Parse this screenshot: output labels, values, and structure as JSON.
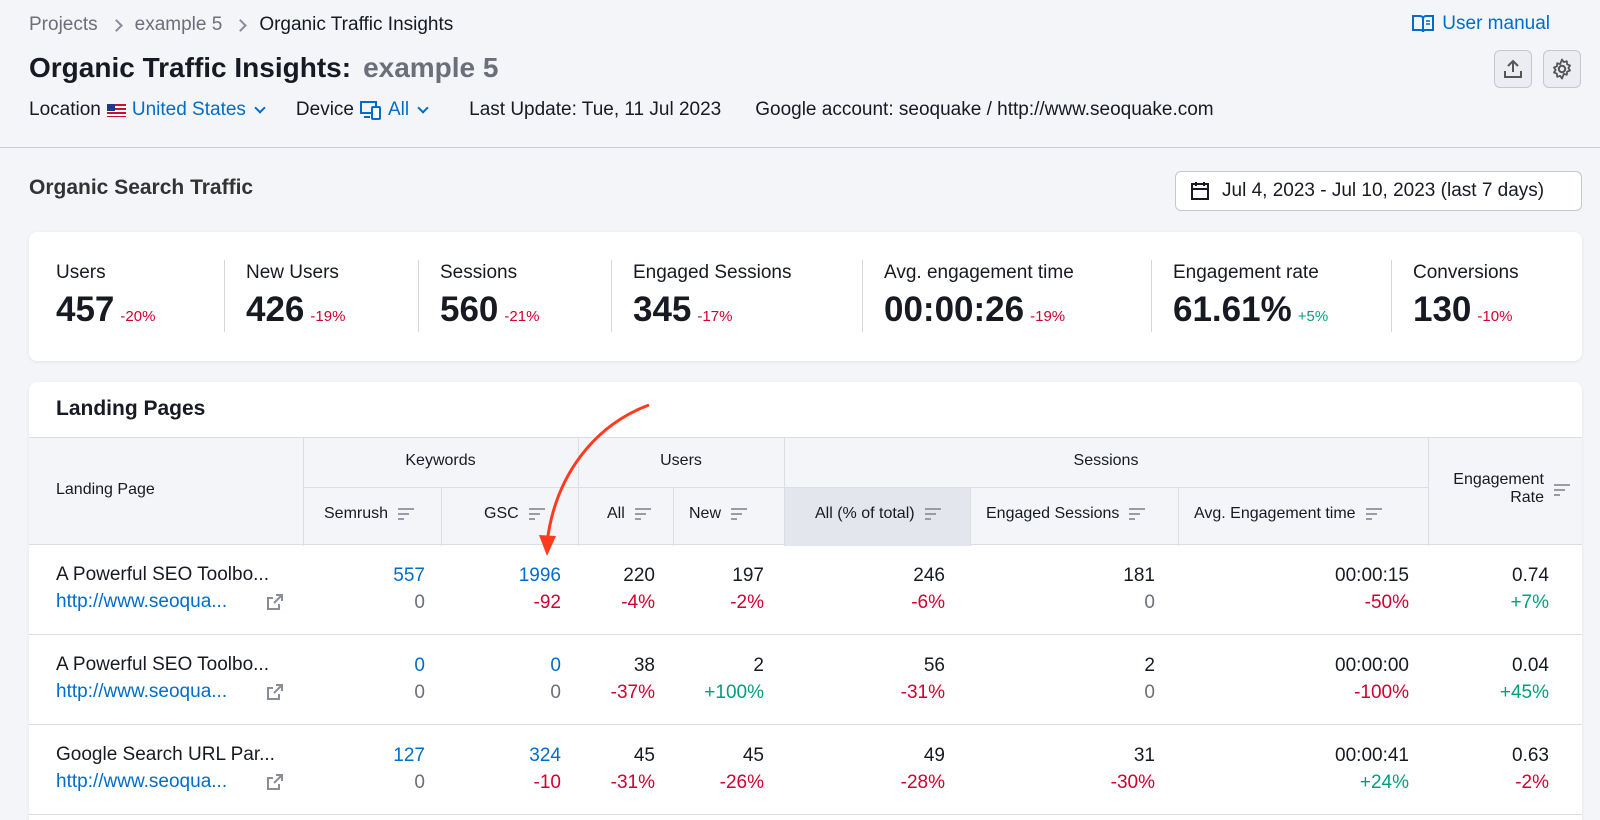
{
  "breadcrumb": [
    "Projects",
    "example 5",
    "Organic Traffic Insights"
  ],
  "user_manual": "User manual",
  "title": {
    "main": "Organic Traffic Insights:",
    "project": "example 5"
  },
  "meta": {
    "location_label": "Location",
    "location_value": "United States",
    "device_label": "Device",
    "device_value": "All",
    "last_update": "Last Update: Tue, 11 Jul 2023",
    "google_account": "Google account: seoquake / http://www.seoquake.com"
  },
  "section_title": "Organic Search Traffic",
  "date_range": "Jul 4, 2023 - Jul 10, 2023 (last 7 days)",
  "stats": [
    {
      "label": "Users",
      "value": "457",
      "change": "-20%"
    },
    {
      "label": "New Users",
      "value": "426",
      "change": "-19%"
    },
    {
      "label": "Sessions",
      "value": "560",
      "change": "-21%"
    },
    {
      "label": "Engaged Sessions",
      "value": "345",
      "change": "-17%"
    },
    {
      "label": "Avg. engagement time",
      "value": "00:00:26",
      "change": "-19%"
    },
    {
      "label": "Engagement rate",
      "value": "61.61%",
      "change": "+5%"
    },
    {
      "label": "Conversions",
      "value": "130",
      "change": "-10%"
    }
  ],
  "landing": {
    "title": "Landing Pages",
    "headers": {
      "landing_page": "Landing Page",
      "keywords": "Keywords",
      "users": "Users",
      "sessions": "Sessions",
      "engagement_rate_1": "Engagement",
      "engagement_rate_2": "Rate",
      "semrush": "Semrush",
      "gsc": "GSC",
      "all": "All",
      "new": "New",
      "all_total": "All (% of total)",
      "engaged_sessions": "Engaged Sessions",
      "avg_engagement_time": "Avg. Engagement time"
    },
    "rows": [
      {
        "name": "A Powerful SEO Toolbo...",
        "url": "http://www.seoqua...",
        "semrush": "557",
        "semrush_d": "0",
        "gsc": "1996",
        "gsc_d": "-92",
        "users_all": "220",
        "users_all_d": "-4%",
        "users_new": "197",
        "users_new_d": "-2%",
        "sessions_all": "246",
        "sessions_all_d": "-6%",
        "engaged": "181",
        "engaged_d": "0",
        "avg_time": "00:00:15",
        "avg_time_d": "-50%",
        "eng_rate": "0.74",
        "eng_rate_d": "+7%"
      },
      {
        "name": "A Powerful SEO Toolbo...",
        "url": "http://www.seoqua...",
        "semrush": "0",
        "semrush_d": "0",
        "gsc": "0",
        "gsc_d": "0",
        "users_all": "38",
        "users_all_d": "-37%",
        "users_new": "2",
        "users_new_d": "+100%",
        "sessions_all": "56",
        "sessions_all_d": "-31%",
        "engaged": "2",
        "engaged_d": "0",
        "avg_time": "00:00:00",
        "avg_time_d": "-100%",
        "eng_rate": "0.04",
        "eng_rate_d": "+45%"
      },
      {
        "name": "Google Search URL Par...",
        "url": "http://www.seoqua...",
        "semrush": "127",
        "semrush_d": "0",
        "gsc": "324",
        "gsc_d": "-10",
        "users_all": "45",
        "users_all_d": "-31%",
        "users_new": "45",
        "users_new_d": "-26%",
        "sessions_all": "49",
        "sessions_all_d": "-28%",
        "engaged": "31",
        "engaged_d": "-30%",
        "avg_time": "00:00:41",
        "avg_time_d": "+24%",
        "eng_rate": "0.63",
        "eng_rate_d": "-2%"
      }
    ]
  },
  "colors": {
    "accent": "#006dca",
    "negative": "#d1002f",
    "positive": "#009f81",
    "annotation": "#ff3b1f"
  }
}
